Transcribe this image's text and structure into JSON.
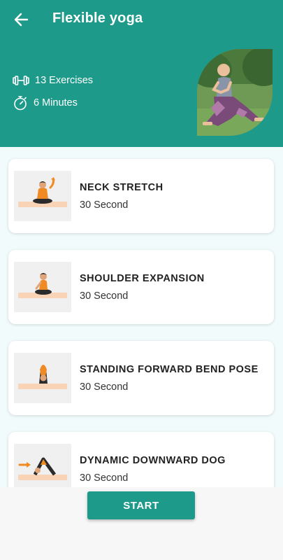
{
  "header": {
    "title": "Flexible yoga",
    "exercises_count": "13 Exercises",
    "duration": "6 Minutes",
    "background_color": "#1e9a8b"
  },
  "icons": {
    "back": "arrow-left-icon",
    "exercises": "dumbbell-icon",
    "duration": "stopwatch-icon"
  },
  "exercises": [
    {
      "name": "NECK STRETCH",
      "duration": "30 Second"
    },
    {
      "name": "SHOULDER EXPANSION",
      "duration": "30 Second"
    },
    {
      "name": "STANDING FORWARD BEND POSE",
      "duration": "30 Second"
    },
    {
      "name": "DYNAMIC DOWNWARD DOG",
      "duration": "30 Second"
    }
  ],
  "footer": {
    "start_label": "START"
  },
  "colors": {
    "accent": "#1e9a8b",
    "mat": "#f9d3b5",
    "figure_shirt": "#f08a24"
  }
}
